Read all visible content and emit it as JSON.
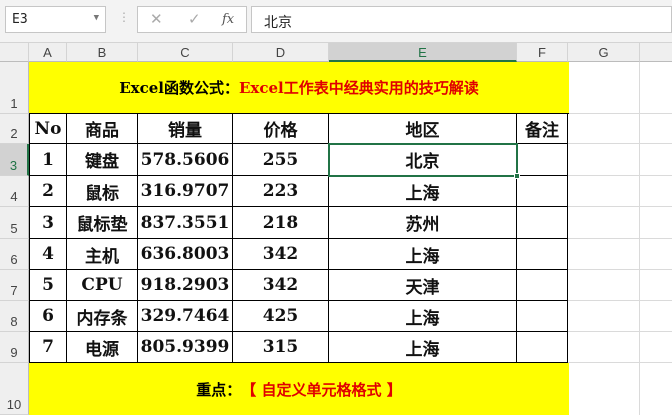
{
  "formula_bar": {
    "name_box": "E3",
    "cancel_icon": "✕",
    "enter_icon": "✓",
    "fx_label": "fx",
    "value": "北京"
  },
  "columns": [
    "A",
    "B",
    "C",
    "D",
    "E",
    "F",
    "G"
  ],
  "rows": [
    "1",
    "2",
    "3",
    "4",
    "5",
    "6",
    "7",
    "8",
    "9",
    "10"
  ],
  "selected_cell": "E3",
  "title": {
    "part1": "Excel函数公式：",
    "part2": "Excel工作表中经典实用的技巧解读"
  },
  "headers": [
    "No",
    "商品",
    "销量",
    "价格",
    "地区",
    "备注"
  ],
  "table": [
    [
      "1",
      "键盘",
      "578.5606",
      "255",
      "北京",
      ""
    ],
    [
      "2",
      "鼠标",
      "316.9707",
      "223",
      "上海",
      ""
    ],
    [
      "3",
      "鼠标垫",
      "837.3551",
      "218",
      "苏州",
      ""
    ],
    [
      "4",
      "主机",
      "636.8003",
      "342",
      "上海",
      ""
    ],
    [
      "5",
      "CPU",
      "918.2903",
      "342",
      "天津",
      ""
    ],
    [
      "6",
      "内存条",
      "329.7464",
      "425",
      "上海",
      ""
    ],
    [
      "7",
      "电源",
      "805.9399",
      "315",
      "上海",
      ""
    ]
  ],
  "footer": {
    "part1": "重点：",
    "part2": "【 自定义单元格格式 】"
  },
  "colors": {
    "highlight": "#ffff00",
    "accent_red": "#e00000",
    "selection": "#217346"
  }
}
